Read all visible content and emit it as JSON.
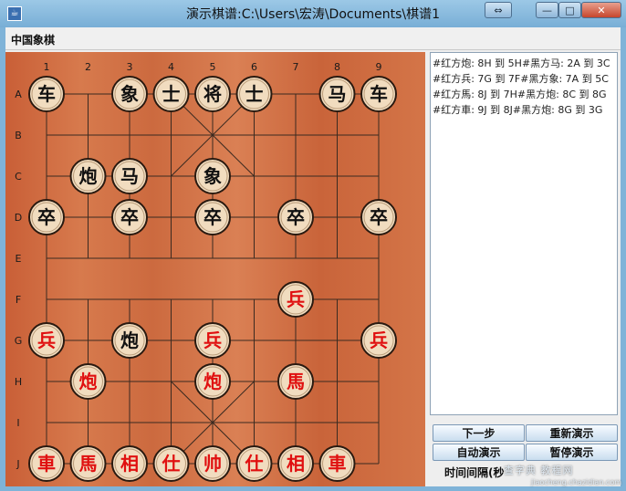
{
  "window": {
    "title": "演示棋谱:C:\\Users\\宏涛\\Documents\\棋谱1",
    "app_icon": "java-cup-icon",
    "buttons": {
      "restore": "⇔",
      "minimize": "—",
      "maximize": "□",
      "close": "✕"
    }
  },
  "menu": {
    "items": [
      "中国象棋"
    ]
  },
  "board": {
    "col_labels": [
      "1",
      "2",
      "3",
      "4",
      "5",
      "6",
      "7",
      "8",
      "9"
    ],
    "row_labels": [
      "A",
      "B",
      "C",
      "D",
      "E",
      "F",
      "G",
      "H",
      "I",
      "J"
    ],
    "pieces": [
      {
        "ch": "车",
        "side": "black",
        "col": 1,
        "row": "A"
      },
      {
        "ch": "象",
        "side": "black",
        "col": 3,
        "row": "A"
      },
      {
        "ch": "士",
        "side": "black",
        "col": 4,
        "row": "A"
      },
      {
        "ch": "将",
        "side": "black",
        "col": 5,
        "row": "A"
      },
      {
        "ch": "士",
        "side": "black",
        "col": 6,
        "row": "A"
      },
      {
        "ch": "马",
        "side": "black",
        "col": 8,
        "row": "A"
      },
      {
        "ch": "车",
        "side": "black",
        "col": 9,
        "row": "A"
      },
      {
        "ch": "炮",
        "side": "black",
        "col": 2,
        "row": "C"
      },
      {
        "ch": "马",
        "side": "black",
        "col": 3,
        "row": "C"
      },
      {
        "ch": "象",
        "side": "black",
        "col": 5,
        "row": "C"
      },
      {
        "ch": "卒",
        "side": "black",
        "col": 1,
        "row": "D"
      },
      {
        "ch": "卒",
        "side": "black",
        "col": 3,
        "row": "D"
      },
      {
        "ch": "卒",
        "side": "black",
        "col": 5,
        "row": "D"
      },
      {
        "ch": "卒",
        "side": "black",
        "col": 7,
        "row": "D"
      },
      {
        "ch": "卒",
        "side": "black",
        "col": 9,
        "row": "D"
      },
      {
        "ch": "兵",
        "side": "red",
        "col": 7,
        "row": "F"
      },
      {
        "ch": "兵",
        "side": "red",
        "col": 1,
        "row": "G"
      },
      {
        "ch": "炮",
        "side": "black",
        "col": 3,
        "row": "G"
      },
      {
        "ch": "兵",
        "side": "red",
        "col": 5,
        "row": "G"
      },
      {
        "ch": "兵",
        "side": "red",
        "col": 9,
        "row": "G"
      },
      {
        "ch": "炮",
        "side": "red",
        "col": 2,
        "row": "H"
      },
      {
        "ch": "炮",
        "side": "red",
        "col": 5,
        "row": "H"
      },
      {
        "ch": "馬",
        "side": "red",
        "col": 7,
        "row": "H"
      },
      {
        "ch": "車",
        "side": "red",
        "col": 1,
        "row": "J"
      },
      {
        "ch": "馬",
        "side": "red",
        "col": 2,
        "row": "J"
      },
      {
        "ch": "相",
        "side": "red",
        "col": 3,
        "row": "J"
      },
      {
        "ch": "仕",
        "side": "red",
        "col": 4,
        "row": "J"
      },
      {
        "ch": "帅",
        "side": "red",
        "col": 5,
        "row": "J"
      },
      {
        "ch": "仕",
        "side": "red",
        "col": 6,
        "row": "J"
      },
      {
        "ch": "相",
        "side": "red",
        "col": 7,
        "row": "J"
      },
      {
        "ch": "車",
        "side": "red",
        "col": 8,
        "row": "J"
      }
    ]
  },
  "log": {
    "lines": [
      "#红方炮: 8H 到 5H#黑方马: 2A 到 3C",
      "#红方兵: 7G 到 7F#黑方象: 7A 到 5C",
      "#红方馬: 8J 到 7H#黑方炮: 8C 到 8G",
      "#红方車: 9J 到 8J#黑方炮: 8G 到 3G"
    ]
  },
  "controls": {
    "next": "下一步",
    "restart": "重新演示",
    "auto": "自动演示",
    "pause": "暂停演示",
    "interval_label": "时间间隔(秒"
  },
  "watermark": {
    "text": "查字典 教程网",
    "sub": "jiaocheng.chazidian.com"
  },
  "colors": {
    "red_piece": "#e01010",
    "black_piece": "#111111",
    "piece_face": "#f1dcbf",
    "board": "#d27448"
  }
}
